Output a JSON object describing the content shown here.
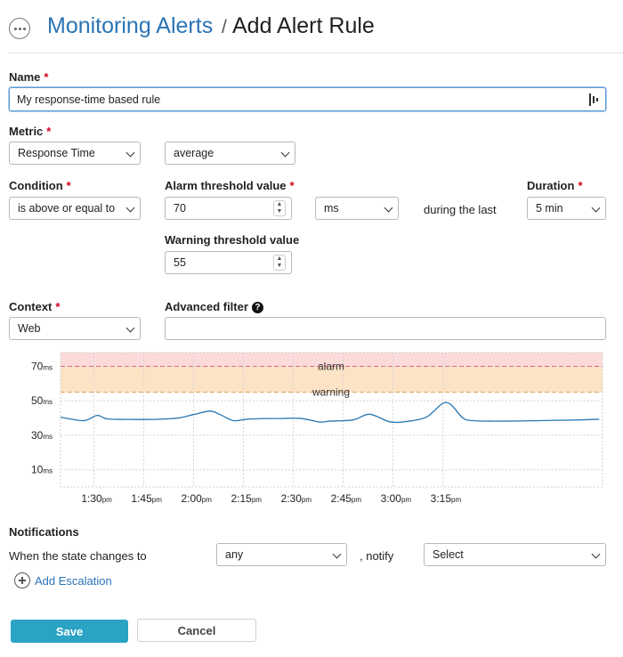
{
  "header": {
    "breadcrumb_link": "Monitoring Alerts",
    "separator": "/",
    "current_page": "Add Alert Rule",
    "menu_icon": "ellipsis-circle-icon"
  },
  "form": {
    "name": {
      "label": "Name",
      "value": "My response-time based rule",
      "extension_icon": "password-manager-icon"
    },
    "metric": {
      "label": "Metric",
      "metric_value": "Response Time",
      "aggregation_value": "average"
    },
    "condition": {
      "label": "Condition",
      "value": "is above or equal to"
    },
    "alarm_threshold": {
      "label": "Alarm threshold value",
      "value": "70",
      "unit": "ms"
    },
    "during_text": "during the last",
    "duration": {
      "label": "Duration",
      "value": "5 min"
    },
    "warning_threshold": {
      "label": "Warning threshold value",
      "value": "55"
    },
    "context": {
      "label": "Context",
      "value": "Web"
    },
    "advanced_filter": {
      "label": "Advanced filter",
      "value": "",
      "help_icon": "question-circle-icon"
    },
    "required_marker": "*"
  },
  "chart_data": {
    "type": "line",
    "title": "",
    "y_ticks": [
      {
        "value": 70,
        "label": "70",
        "unit": "ms"
      },
      {
        "value": 50,
        "label": "50",
        "unit": "ms"
      },
      {
        "value": 30,
        "label": "30",
        "unit": "ms"
      },
      {
        "value": 10,
        "label": "10",
        "unit": "ms"
      }
    ],
    "x_ticks": [
      {
        "label": "1:30",
        "suffix": "pm"
      },
      {
        "label": "1:45",
        "suffix": "pm"
      },
      {
        "label": "2:00",
        "suffix": "pm"
      },
      {
        "label": "2:15",
        "suffix": "pm"
      },
      {
        "label": "2:30",
        "suffix": "pm"
      },
      {
        "label": "2:45",
        "suffix": "pm"
      },
      {
        "label": "3:00",
        "suffix": "pm"
      },
      {
        "label": "3:15",
        "suffix": "pm"
      }
    ],
    "x_range_minutes_after_1pm": [
      20,
      183
    ],
    "ylim": [
      0,
      78
    ],
    "grid": true,
    "thresholds": [
      {
        "name": "alarm",
        "label": "alarm",
        "value": 70,
        "color": "#e06688",
        "band_color": "#fbdada"
      },
      {
        "name": "warning",
        "label": "warning",
        "value": 55,
        "color": "#e8a15a",
        "band_color": "#fde3c6"
      }
    ],
    "series": [
      {
        "color": "#2878b5",
        "x_minutes_after_1pm": [
          20,
          27,
          31,
          34,
          40,
          48,
          52,
          56,
          60,
          65,
          68,
          72,
          76,
          82,
          86,
          92,
          98,
          101,
          108,
          113,
          119,
          124,
          130,
          136,
          141,
          144,
          149,
          153,
          158,
          164,
          170,
          176,
          182
        ],
        "y_ms": [
          40.5,
          38.5,
          41.5,
          39.5,
          39.2,
          39.2,
          39.5,
          40.2,
          42,
          44,
          42,
          38.5,
          39.3,
          39.7,
          39.7,
          39.8,
          37.7,
          38.2,
          38.9,
          42.2,
          37.8,
          38,
          40.5,
          49,
          40,
          38.5,
          38.2,
          38.2,
          38.3,
          38.5,
          38.7,
          38.9,
          39.3
        ]
      }
    ]
  },
  "notifications": {
    "heading": "Notifications",
    "state_label": "When the state changes to",
    "state_value": "any",
    "notify_label": ", notify",
    "notify_value": "Select",
    "add_escalation": "Add Escalation"
  },
  "actions": {
    "save": "Save",
    "cancel": "Cancel"
  }
}
